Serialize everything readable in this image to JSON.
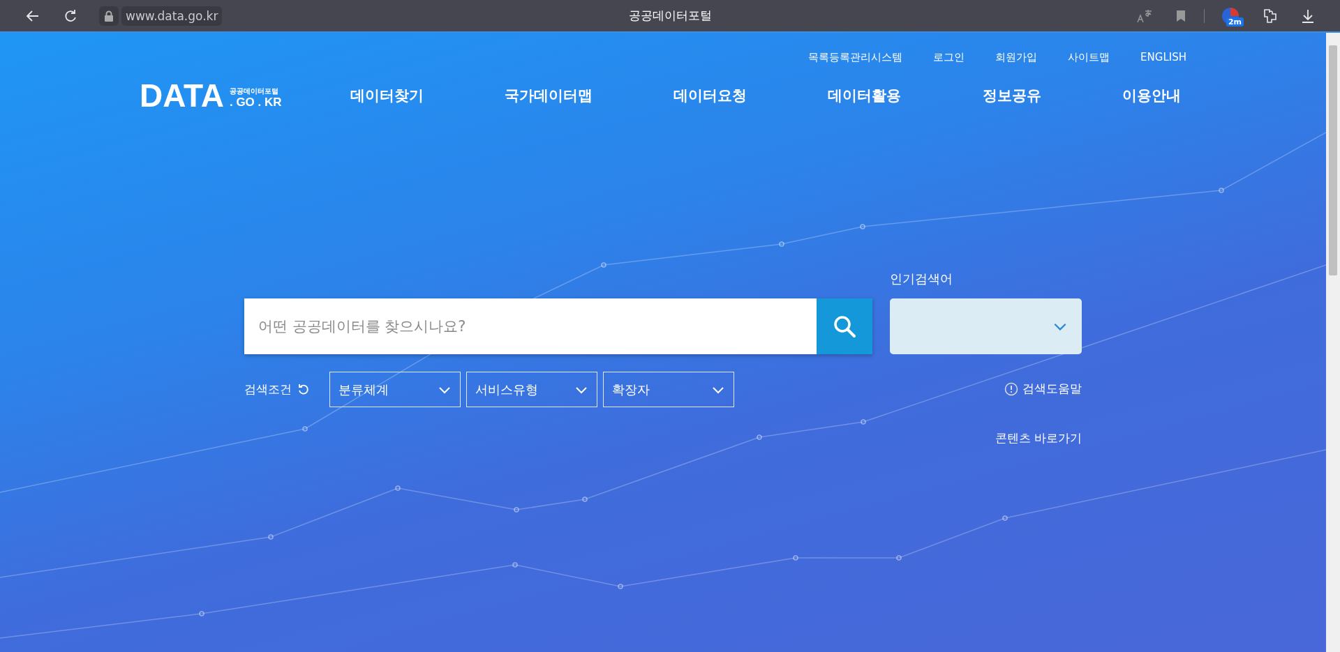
{
  "browser": {
    "url": "www.data.go.kr",
    "title": "공공데이터포털",
    "extension_badge": "2m"
  },
  "utility_links": [
    "목록등록관리시스템",
    "로그인",
    "회원가입",
    "사이트맵",
    "ENGLISH"
  ],
  "logo": {
    "main": "DATA",
    "sub": "공공데이터포털",
    "domain": ". GO . KR"
  },
  "nav": [
    "데이터찾기",
    "국가데이터맵",
    "데이터요청",
    "데이터활용",
    "정보공유",
    "이용안내"
  ],
  "search": {
    "placeholder": "어떤 공공데이터를 찾으시나요?"
  },
  "popular": {
    "label": "인기검색어"
  },
  "filters": {
    "label": "검색조건",
    "selects": [
      "분류체계",
      "서비스유형",
      "확장자"
    ]
  },
  "help_link": "검색도움말",
  "contents_link": "콘텐츠 바로가기"
}
